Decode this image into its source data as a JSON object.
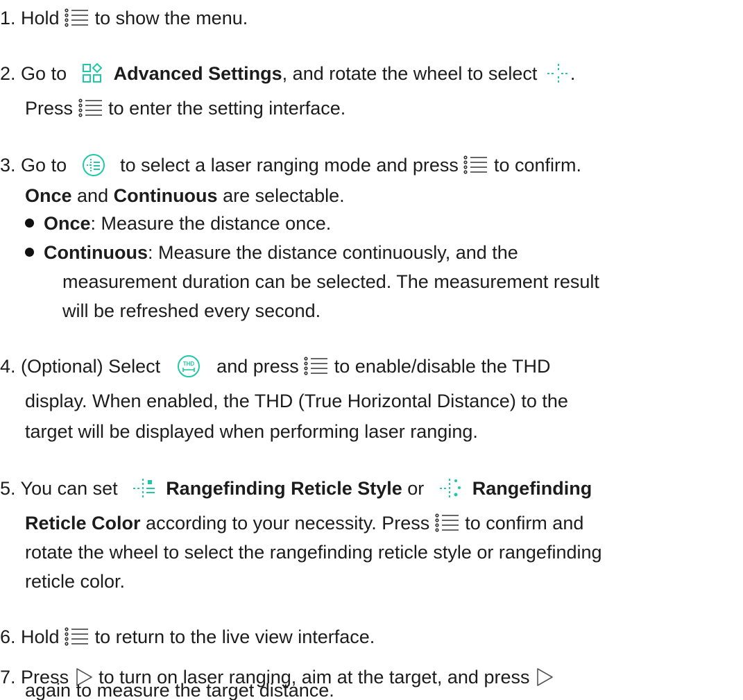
{
  "steps": {
    "s1": {
      "num": "1.",
      "a": "Hold",
      "b": "to show the menu."
    },
    "s2": {
      "num": "2.",
      "a": "Go to",
      "bold": "Advanced Settings",
      "b": ", and rotate the wheel to select",
      "c": ".",
      "l2a": "Press",
      "l2b": "to enter the setting interface."
    },
    "s3": {
      "num": "3.",
      "a": "Go to",
      "b": "to select a laser ranging mode and press",
      "c": "to confirm.",
      "l2_once": "Once",
      "l2_and": " and ",
      "l2_cont": "Continuous",
      "l2_rest": " are selectable.",
      "bullets": [
        {
          "term": "Once",
          "text": ": Measure the distance once."
        },
        {
          "term": "Continuous",
          "text": ": Measure the distance continuously, and the",
          "cont": [
            "measurement duration can be selected. The measurement result",
            "will be refreshed every second."
          ]
        }
      ]
    },
    "s4": {
      "num": "4.",
      "a": "(Optional) Select",
      "b": "and press",
      "c": "to enable/disable the THD",
      "l2": "display. When enabled, the THD (True Horizontal Distance) to the",
      "l3": "target will be displayed when performing laser ranging.",
      "thd_icon_text": "THD"
    },
    "s5": {
      "num": "5.",
      "a": "You can set",
      "bold1": "Rangefinding Reticle Style",
      "or": " or ",
      "bold2a": "Rangefinding",
      "l2bold": "Reticle Color",
      "l2a": " according to your necessity. Press",
      "l2b": "to confirm and",
      "l3": "rotate the wheel to select the rangefinding reticle style or rangefinding",
      "l4": "reticle color."
    },
    "s6": {
      "num": "6.",
      "a": "Hold",
      "b": "to return to the live view interface."
    },
    "s7": {
      "num": "7.",
      "a": "Press",
      "b": "to turn on laser ranging, aim at the target, and press",
      "l2": "again to measure the target distance."
    }
  },
  "icons": {
    "menu": "menu-icon",
    "advanced": "advanced-settings-icon",
    "laser": "laser-rangefinding-icon",
    "mode": "ranging-mode-icon",
    "thd": "thd-icon",
    "style": "reticle-style-icon",
    "color": "reticle-color-icon",
    "play": "play-icon"
  },
  "colors": {
    "accent": "#1fc9a6",
    "text": "#1c1c1c"
  }
}
